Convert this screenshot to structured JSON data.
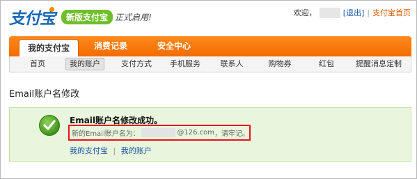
{
  "header": {
    "logo_text": "支付宝",
    "logo_badge": "新版支付宝",
    "logo_tail": "正式启用!",
    "welcome": "欢迎，",
    "logout": "[退出]",
    "home_link": "支付宝首页"
  },
  "nav": {
    "tabs": [
      "我的支付宝",
      "消费记录",
      "安全中心"
    ],
    "subitems": [
      "首页",
      "我的账户",
      "支付方式",
      "手机服务",
      "联系人",
      "购物券",
      "红包",
      "提醒消息定制"
    ]
  },
  "page": {
    "title": "Email账户名修改"
  },
  "success": {
    "message": "Email账户名修改成功。",
    "new_email_prefix": "新的Email账户名为：",
    "new_email_domain": "@126.com",
    "new_email_suffix": "，请牢记。",
    "link_my_alipay": "我的支付宝",
    "link_sep": "|",
    "link_my_account": "我的账户"
  },
  "colors": {
    "nav_orange": "#f46b00",
    "link_blue": "#1454a5",
    "success_bg": "#e9f5dc",
    "highlight_red": "#e8141b"
  }
}
